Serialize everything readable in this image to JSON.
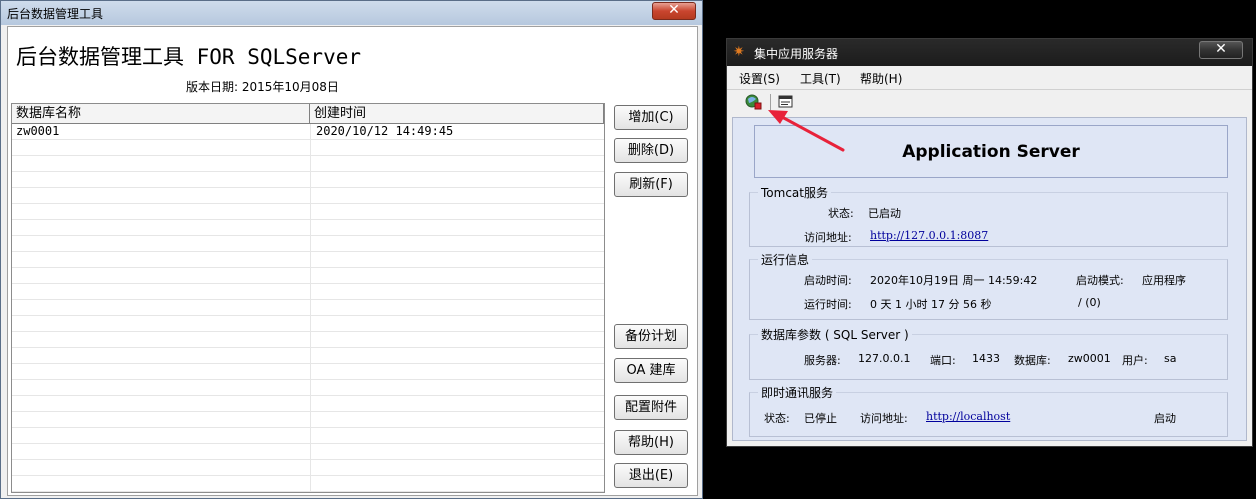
{
  "left_window": {
    "title": "后台数据管理工具",
    "close": "✕",
    "app_title": "后台数据管理工具 FOR SQLServer",
    "version": "版本日期: 2015年10月08日",
    "table": {
      "headers": [
        "数据库名称",
        "创建时间"
      ],
      "rows": [
        {
          "name": "zw0001",
          "created": "2020/10/12 14:49:45"
        }
      ]
    },
    "buttons": {
      "add": "增加(C)",
      "delete": "删除(D)",
      "refresh": "刷新(F)",
      "backup": "备份计划",
      "create_oa": "OA 建库",
      "attach": "配置附件",
      "help": "帮助(H)",
      "exit": "退出(E)"
    }
  },
  "right_window": {
    "title": "集中应用服务器",
    "close": "✕",
    "menu": [
      "设置(S)",
      "工具(T)",
      "帮助(H)"
    ],
    "toolbar_icons": [
      "server-icon",
      "console-icon"
    ],
    "banner": "Application Server",
    "tomcat": {
      "title": "Tomcat服务",
      "status_label": "状态:",
      "status_value": "已启动",
      "address_label": "访问地址:",
      "address_value": "http://127.0.0.1:8087"
    },
    "runtime": {
      "title": "运行信息",
      "start_label": "启动时间:",
      "start_value": "2020年10月19日  周一  14:59:42",
      "mode_label": "启动模式:",
      "mode_value": "应用程序",
      "uptime_label": "运行时间:",
      "uptime_value": "0 天 1 小时 17 分 56 秒",
      "extra_value": "/  (0)"
    },
    "database": {
      "title": "数据库参数 ( SQL Server )",
      "server_label": "服务器:",
      "server_value": "127.0.0.1",
      "port_label": "端口:",
      "port_value": "1433",
      "db_label": "数据库:",
      "db_value": "zw0001",
      "user_label": "用户:",
      "user_value": "sa"
    },
    "im": {
      "title": "即时通讯服务",
      "status_label": "状态:",
      "status_value": "已停止",
      "address_label": "访问地址:",
      "address_value": "http://localhost",
      "action": "启动"
    }
  },
  "colors": {
    "content_bg": "#dfe6f5",
    "annotation_arrow": "#e8223a",
    "link": "#00009c"
  }
}
